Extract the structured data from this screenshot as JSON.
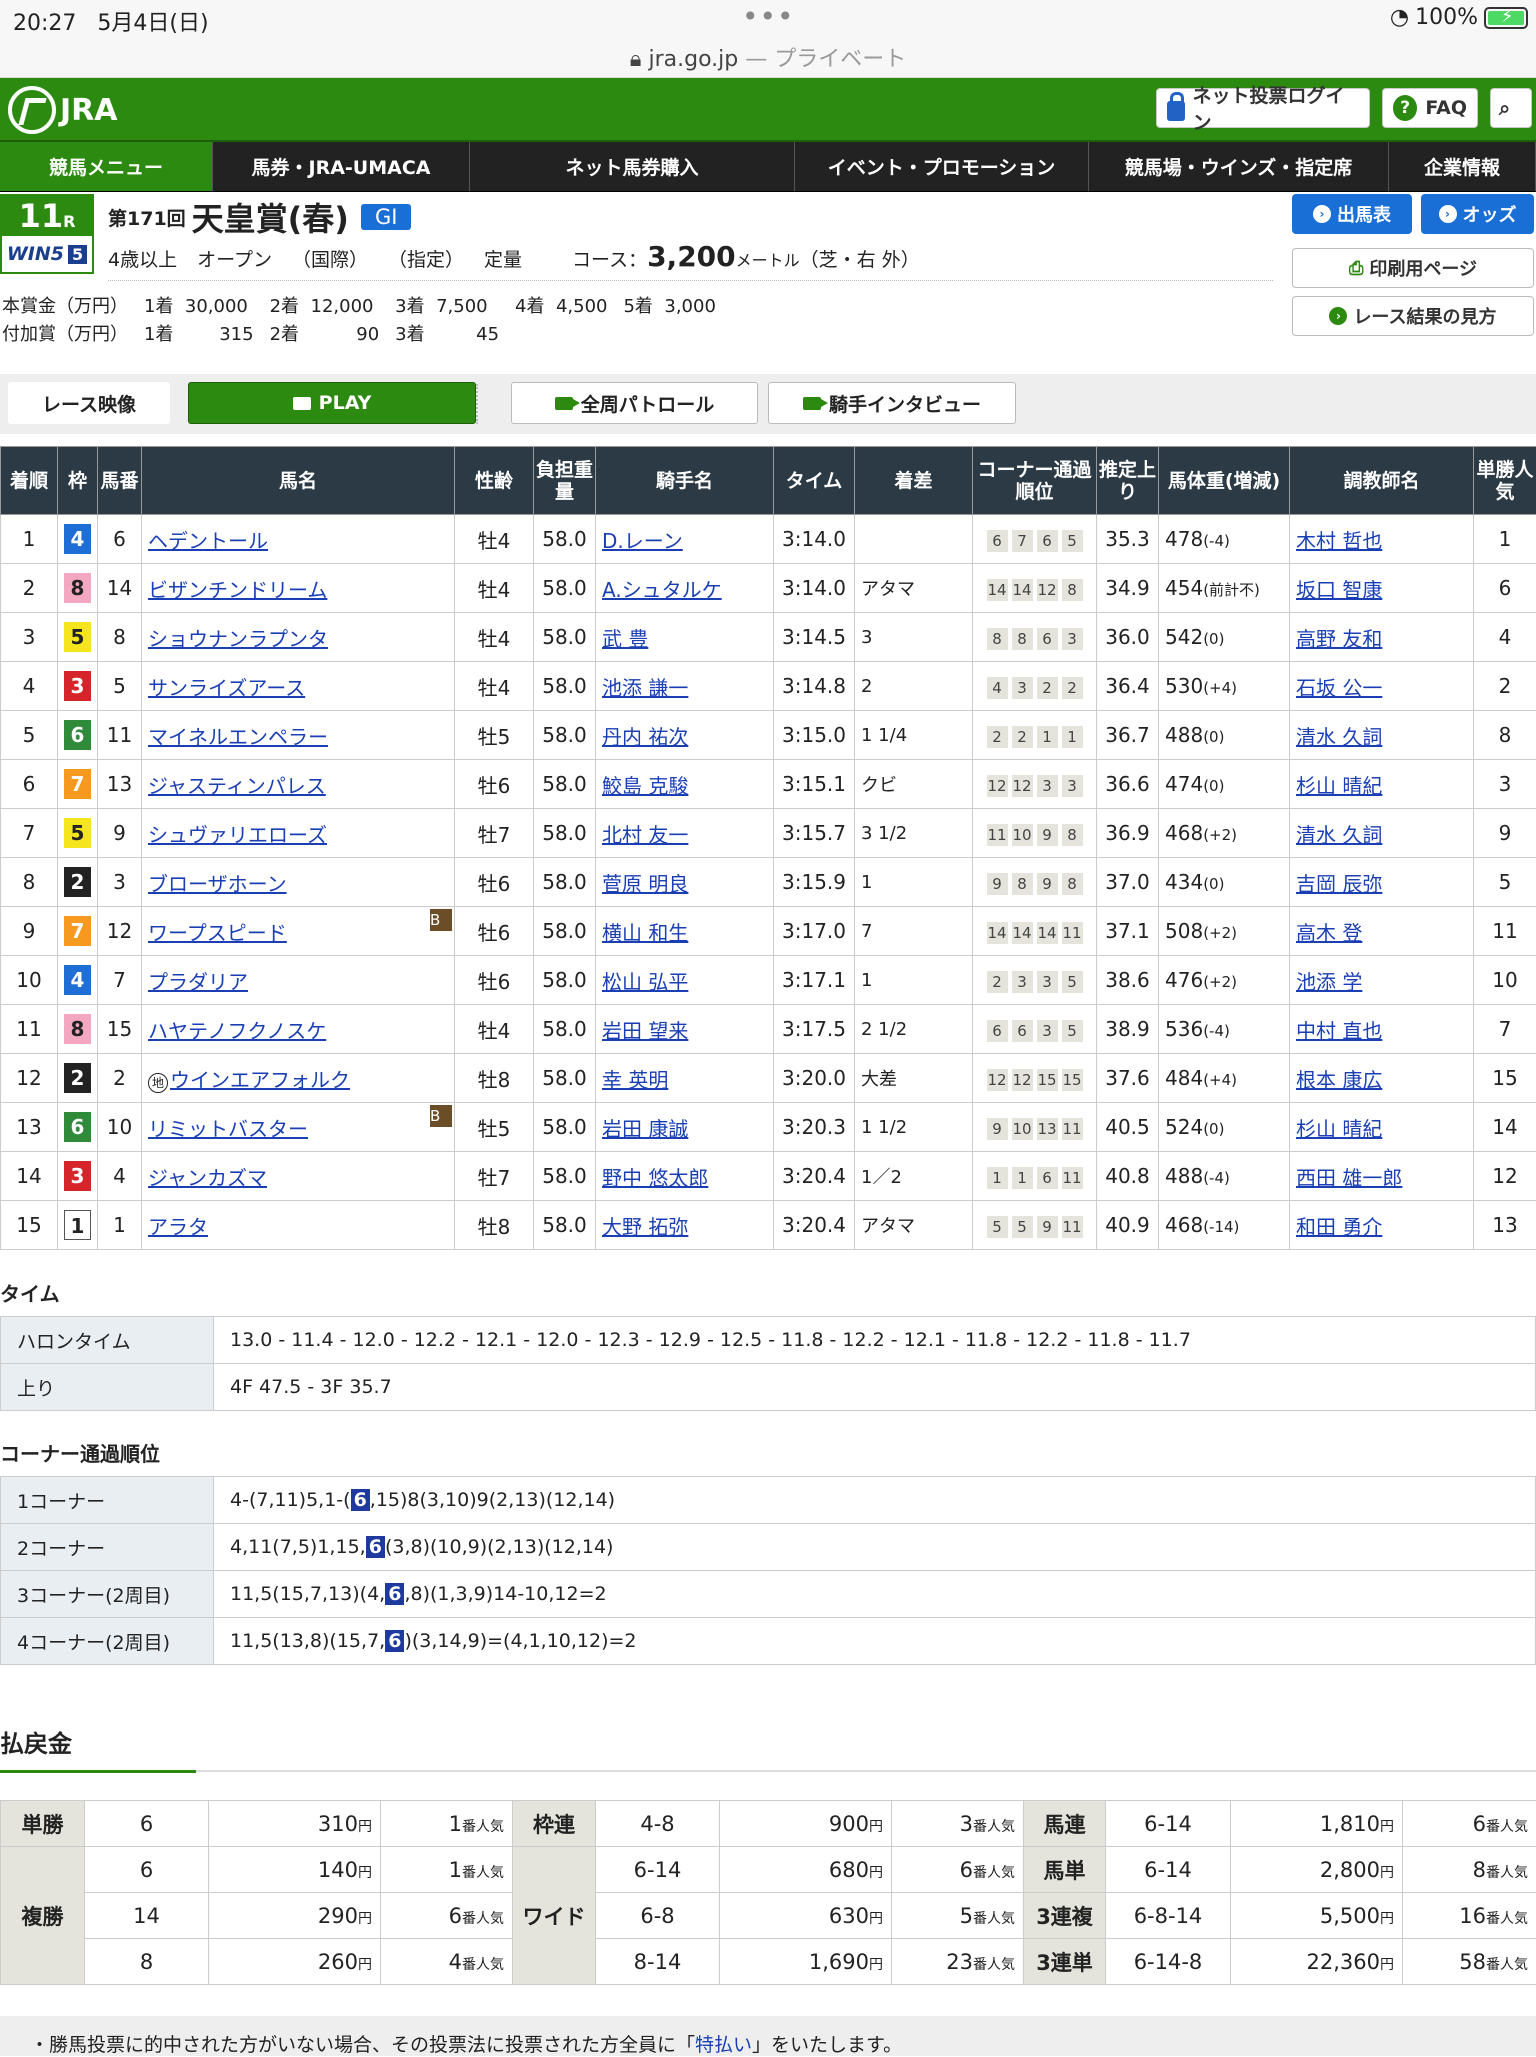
{
  "status": {
    "time": "20:27",
    "date": "5月4日(日)",
    "battery": "100%",
    "battery_level": 1.0
  },
  "url": {
    "domain": "jra.go.jp",
    "suffix": " — プライベート"
  },
  "header": {
    "logo": "JRA",
    "login": "ネット投票ログイン",
    "faq": "FAQ"
  },
  "nav": [
    "競馬メニュー",
    "馬券・JRA-UMACA",
    "ネット馬券購入",
    "イベント・プロモーション",
    "競馬場・ウインズ・指定席",
    "企業情報"
  ],
  "race": {
    "num": "11",
    "r": "R",
    "win5": "WIN5",
    "win5_n": "5",
    "kai": "第171回",
    "name": "天皇賞(春)",
    "grade": "GI",
    "cond1": "4歳以上",
    "cond2": "オープン",
    "cond3": "（国際）",
    "cond4": "（指定）",
    "cond5": "定量",
    "course_label": "コース：",
    "distance": "3,200",
    "unit": "メートル",
    "surface": "（芝・右 外）"
  },
  "prize": {
    "main_label": "本賞金（万円）",
    "add_label": "付加賞（万円）",
    "main": [
      [
        "1着",
        "30,000"
      ],
      [
        "2着",
        "12,000"
      ],
      [
        "3着",
        "7,500"
      ],
      [
        "4着",
        "4,500"
      ],
      [
        "5着",
        "3,000"
      ]
    ],
    "add": [
      [
        "1着",
        "315"
      ],
      [
        "2着",
        "90"
      ],
      [
        "3着",
        "45"
      ]
    ]
  },
  "buttons": {
    "shutuba": "出馬表",
    "odds": "オッズ",
    "print": "印刷用ページ",
    "guide": "レース結果の見方"
  },
  "video": {
    "label": "レース映像",
    "play": "PLAY",
    "patrol": "全周パトロール",
    "interview": "騎手インタビュー"
  },
  "table_headers": [
    "着順",
    "枠",
    "馬番",
    "馬名",
    "性齢",
    "負担重量",
    "騎手名",
    "タイム",
    "着差",
    "コーナー通過順位",
    "推定上り",
    "馬体重(増減)",
    "調教師名",
    "単勝人気"
  ],
  "results": [
    {
      "pos": "1",
      "waku": "4",
      "no": "6",
      "horse": "ヘデントール",
      "b": "",
      "chi": "",
      "sex": "牡4",
      "wt": "58.0",
      "jockey": "D.レーン",
      "time": "3:14.0",
      "margin": "",
      "corner": [
        "6",
        "7",
        "6",
        "5"
      ],
      "agari": "35.3",
      "bw": "478",
      "bwd": "(-4)",
      "trainer": "木村 哲也",
      "pop": "1"
    },
    {
      "pos": "2",
      "waku": "8",
      "no": "14",
      "horse": "ビザンチンドリーム",
      "b": "",
      "chi": "",
      "sex": "牡4",
      "wt": "58.0",
      "jockey": "A.シュタルケ",
      "time": "3:14.0",
      "margin": "アタマ",
      "corner": [
        "14",
        "14",
        "12",
        "8"
      ],
      "agari": "34.9",
      "bw": "454",
      "bwd": "(前計不)",
      "trainer": "坂口 智康",
      "pop": "6"
    },
    {
      "pos": "3",
      "waku": "5",
      "no": "8",
      "horse": "ショウナンラプンタ",
      "b": "",
      "chi": "",
      "sex": "牡4",
      "wt": "58.0",
      "jockey": "武 豊",
      "time": "3:14.5",
      "margin": "3",
      "corner": [
        "8",
        "8",
        "6",
        "3"
      ],
      "agari": "36.0",
      "bw": "542",
      "bwd": "(0)",
      "trainer": "高野 友和",
      "pop": "4"
    },
    {
      "pos": "4",
      "waku": "3",
      "no": "5",
      "horse": "サンライズアース",
      "b": "",
      "chi": "",
      "sex": "牡4",
      "wt": "58.0",
      "jockey": "池添 謙一",
      "time": "3:14.8",
      "margin": "2",
      "corner": [
        "4",
        "3",
        "2",
        "2"
      ],
      "agari": "36.4",
      "bw": "530",
      "bwd": "(+4)",
      "trainer": "石坂 公一",
      "pop": "2"
    },
    {
      "pos": "5",
      "waku": "6",
      "no": "11",
      "horse": "マイネルエンペラー",
      "b": "",
      "chi": "",
      "sex": "牡5",
      "wt": "58.0",
      "jockey": "丹内 祐次",
      "time": "3:15.0",
      "margin": "1 1/4",
      "corner": [
        "2",
        "2",
        "1",
        "1"
      ],
      "agari": "36.7",
      "bw": "488",
      "bwd": "(0)",
      "trainer": "清水 久詞",
      "pop": "8"
    },
    {
      "pos": "6",
      "waku": "7",
      "no": "13",
      "horse": "ジャスティンパレス",
      "b": "",
      "chi": "",
      "sex": "牡6",
      "wt": "58.0",
      "jockey": "鮫島 克駿",
      "time": "3:15.1",
      "margin": "クビ",
      "corner": [
        "12",
        "12",
        "3",
        "3"
      ],
      "agari": "36.6",
      "bw": "474",
      "bwd": "(0)",
      "trainer": "杉山 晴紀",
      "pop": "3"
    },
    {
      "pos": "7",
      "waku": "5",
      "no": "9",
      "horse": "シュヴァリエローズ",
      "b": "",
      "chi": "",
      "sex": "牡7",
      "wt": "58.0",
      "jockey": "北村 友一",
      "time": "3:15.7",
      "margin": "3 1/2",
      "corner": [
        "11",
        "10",
        "9",
        "8"
      ],
      "agari": "36.9",
      "bw": "468",
      "bwd": "(+2)",
      "trainer": "清水 久詞",
      "pop": "9"
    },
    {
      "pos": "8",
      "waku": "2",
      "no": "3",
      "horse": "ブローザホーン",
      "b": "",
      "chi": "",
      "sex": "牡6",
      "wt": "58.0",
      "jockey": "菅原 明良",
      "time": "3:15.9",
      "margin": "1",
      "corner": [
        "9",
        "8",
        "9",
        "8"
      ],
      "agari": "37.0",
      "bw": "434",
      "bwd": "(0)",
      "trainer": "吉岡 辰弥",
      "pop": "5"
    },
    {
      "pos": "9",
      "waku": "7",
      "no": "12",
      "horse": "ワープスピード",
      "b": "B",
      "chi": "",
      "sex": "牡6",
      "wt": "58.0",
      "jockey": "横山 和生",
      "time": "3:17.0",
      "margin": "7",
      "corner": [
        "14",
        "14",
        "14",
        "11"
      ],
      "agari": "37.1",
      "bw": "508",
      "bwd": "(+2)",
      "trainer": "高木 登",
      "pop": "11"
    },
    {
      "pos": "10",
      "waku": "4",
      "no": "7",
      "horse": "プラダリア",
      "b": "",
      "chi": "",
      "sex": "牡6",
      "wt": "58.0",
      "jockey": "松山 弘平",
      "time": "3:17.1",
      "margin": "1",
      "corner": [
        "2",
        "3",
        "3",
        "5"
      ],
      "agari": "38.6",
      "bw": "476",
      "bwd": "(+2)",
      "trainer": "池添 学",
      "pop": "10"
    },
    {
      "pos": "11",
      "waku": "8",
      "no": "15",
      "horse": "ハヤテノフクノスケ",
      "b": "",
      "chi": "",
      "sex": "牡4",
      "wt": "58.0",
      "jockey": "岩田 望来",
      "time": "3:17.5",
      "margin": "2 1/2",
      "corner": [
        "6",
        "6",
        "3",
        "5"
      ],
      "agari": "38.9",
      "bw": "536",
      "bwd": "(-4)",
      "trainer": "中村 直也",
      "pop": "7"
    },
    {
      "pos": "12",
      "waku": "2",
      "no": "2",
      "horse": "ウインエアフォルク",
      "b": "",
      "chi": "地",
      "sex": "牡8",
      "wt": "58.0",
      "jockey": "幸 英明",
      "time": "3:20.0",
      "margin": "大差",
      "corner": [
        "12",
        "12",
        "15",
        "15"
      ],
      "agari": "37.6",
      "bw": "484",
      "bwd": "(+4)",
      "trainer": "根本 康広",
      "pop": "15"
    },
    {
      "pos": "13",
      "waku": "6",
      "no": "10",
      "horse": "リミットバスター",
      "b": "B",
      "chi": "",
      "sex": "牡5",
      "wt": "58.0",
      "jockey": "岩田 康誠",
      "time": "3:20.3",
      "margin": "1 1/2",
      "corner": [
        "9",
        "10",
        "13",
        "11"
      ],
      "agari": "40.5",
      "bw": "524",
      "bwd": "(0)",
      "trainer": "杉山 晴紀",
      "pop": "14"
    },
    {
      "pos": "14",
      "waku": "3",
      "no": "4",
      "horse": "ジャンカズマ",
      "b": "",
      "chi": "",
      "sex": "牡7",
      "wt": "58.0",
      "jockey": "野中 悠太郎",
      "time": "3:20.4",
      "margin": "1／2",
      "corner": [
        "1",
        "1",
        "6",
        "11"
      ],
      "agari": "40.8",
      "bw": "488",
      "bwd": "(-4)",
      "trainer": "西田 雄一郎",
      "pop": "12"
    },
    {
      "pos": "15",
      "waku": "1",
      "no": "1",
      "horse": "アラタ",
      "b": "",
      "chi": "",
      "sex": "牡8",
      "wt": "58.0",
      "jockey": "大野 拓弥",
      "time": "3:20.4",
      "margin": "アタマ",
      "corner": [
        "5",
        "5",
        "9",
        "11"
      ],
      "agari": "40.9",
      "bw": "468",
      "bwd": "(-14)",
      "trainer": "和田 勇介",
      "pop": "13"
    }
  ],
  "time_section": {
    "title": "タイム",
    "rows": [
      {
        "label": "ハロンタイム",
        "value": "13.0 - 11.4 - 12.0 - 12.2 - 12.1 - 12.0 - 12.3 - 12.9 - 12.5 - 11.8 - 12.2 - 12.1 - 11.8 - 12.2 - 11.8 - 11.7"
      },
      {
        "label": "上り",
        "value": "4F 47.5 - 3F 35.7"
      }
    ]
  },
  "corner_section": {
    "title": "コーナー通過順位",
    "rows": [
      {
        "label": "1コーナー",
        "pre": "4-(7,11)5,1-(",
        "hl": "6",
        "post": ",15)8(3,10)9(2,13)(12,14)"
      },
      {
        "label": "2コーナー",
        "pre": "4,11(7,5)1,15,",
        "hl": "6",
        "post": "(3,8)(10,9)(2,13)(12,14)"
      },
      {
        "label": "3コーナー(2周目)",
        "pre": "11,5(15,7,13)(4,",
        "hl": "6",
        "post": ",8)(1,3,9)14-10,12=2"
      },
      {
        "label": "4コーナー(2周目)",
        "pre": "11,5(13,8)(15,7,",
        "hl": "6",
        "post": ")(3,14,9)=(4,1,10,12)=2"
      }
    ]
  },
  "payout": {
    "title": "払戻金",
    "yen": "円",
    "ninki": "番人気",
    "tansho": {
      "label": "単勝",
      "rows": [
        [
          "6",
          "310",
          "1"
        ]
      ]
    },
    "fukusho": {
      "label": "複勝",
      "rows": [
        [
          "6",
          "140",
          "1"
        ],
        [
          "14",
          "290",
          "6"
        ],
        [
          "8",
          "260",
          "4"
        ]
      ]
    },
    "wakuren": {
      "label": "枠連",
      "rows": [
        [
          "4-8",
          "900",
          "3"
        ]
      ]
    },
    "wide": {
      "label": "ワイド",
      "rows": [
        [
          "6-14",
          "680",
          "6"
        ],
        [
          "6-8",
          "630",
          "5"
        ],
        [
          "8-14",
          "1,690",
          "23"
        ]
      ]
    },
    "umaren": {
      "label": "馬連",
      "rows": [
        [
          "6-14",
          "1,810",
          "6"
        ]
      ]
    },
    "umatan": {
      "label": "馬単",
      "rows": [
        [
          "6-14",
          "2,800",
          "8"
        ]
      ]
    },
    "sanrenpuku": {
      "label": "3連複",
      "rows": [
        [
          "6-8-14",
          "5,500",
          "16"
        ]
      ]
    },
    "sanrentan": {
      "label": "3連単",
      "rows": [
        [
          "6-14-8",
          "22,360",
          "58"
        ]
      ]
    }
  },
  "note": {
    "pre": "・勝馬投票に的中された方がいない場合、その投票法に投票された方全員に「",
    "link": "特払い",
    "post": "」をいたします。"
  }
}
